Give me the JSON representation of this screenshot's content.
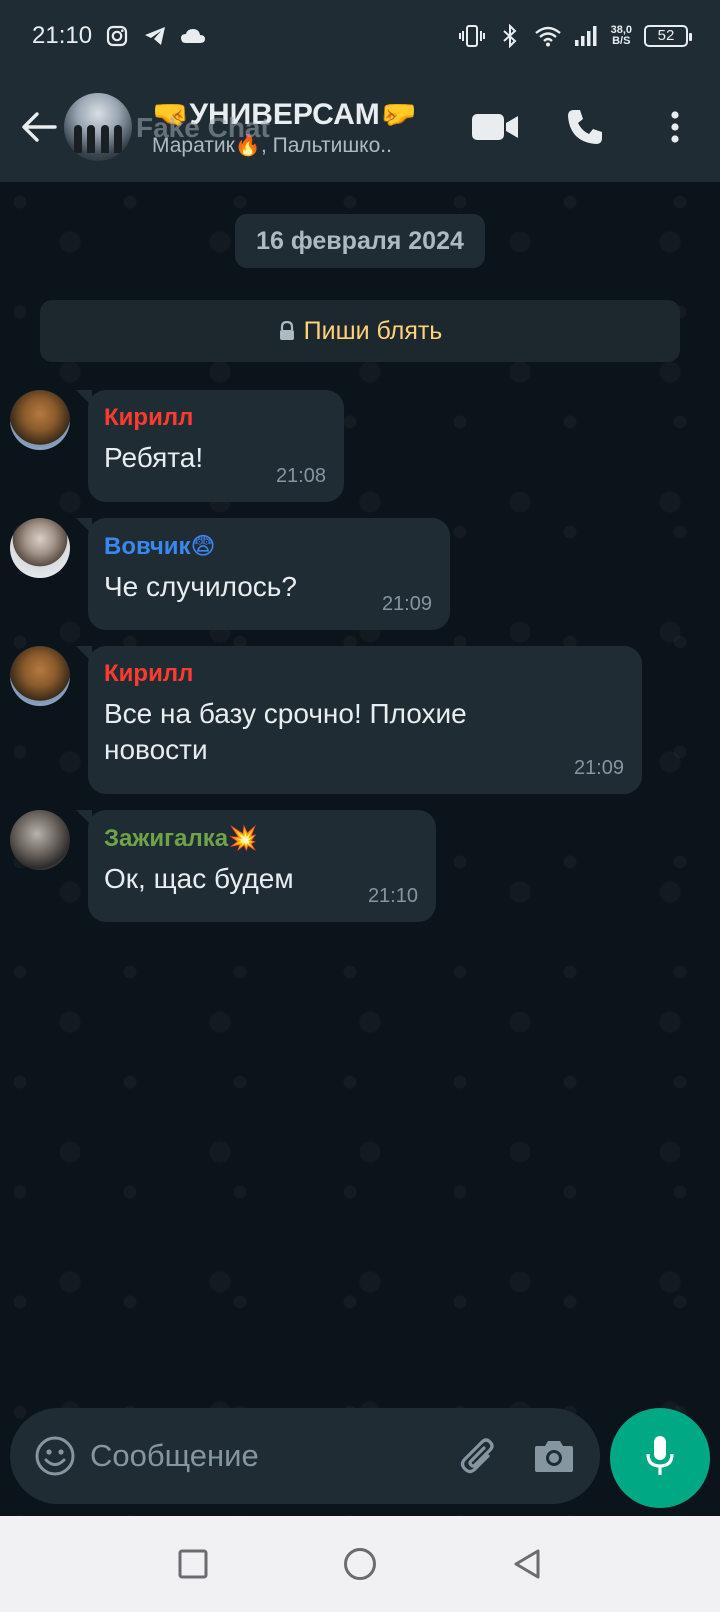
{
  "status_bar": {
    "time": "21:10",
    "net_speed_value": "38,0",
    "net_speed_unit": "B/S",
    "battery": "52",
    "icons": [
      "instagram-icon",
      "telegram-icon",
      "cloud-icon",
      "vibrate-icon",
      "bluetooth-icon",
      "wifi-icon",
      "signal-icon"
    ]
  },
  "header": {
    "title": "🤜УНИВЕРСАМ🤛",
    "subtitle": "Маратик🔥, Пальтишко..",
    "watermark": "Fake Chat"
  },
  "chat": {
    "date": "16 февраля 2024",
    "notice": "Пиши блять",
    "messages": [
      {
        "sender": "Кирилл",
        "sender_color": "#ff3b30",
        "text": "Ребята!",
        "time": "21:08"
      },
      {
        "sender": "Вовчик😨",
        "sender_color": "#3c86f0",
        "text": "Че случилось?",
        "time": "21:09"
      },
      {
        "sender": "Кирилл",
        "sender_color": "#ff3b30",
        "text": "Все на базу срочно! Плохие новости",
        "time": "21:09"
      },
      {
        "sender": "Зажигалка💥",
        "sender_color": "#6fa249",
        "text": "Ок, щас будем",
        "time": "21:10"
      }
    ]
  },
  "composer": {
    "placeholder": "Сообщение"
  },
  "colors": {
    "accent": "#00a884",
    "bubble": "#1f2c34",
    "background": "#0b141a",
    "notice_text": "#ffd279"
  }
}
